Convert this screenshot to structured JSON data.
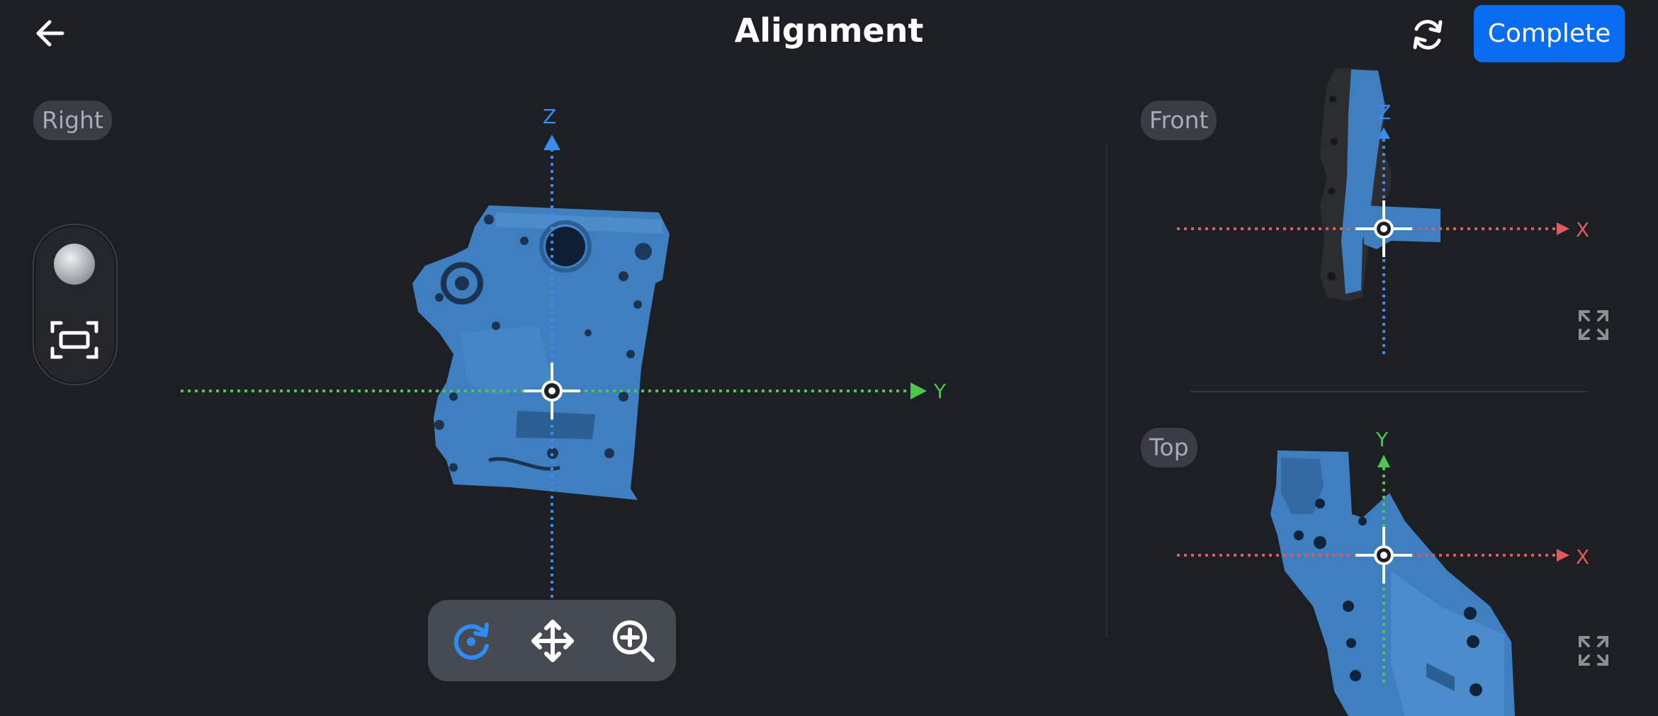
{
  "header": {
    "title": "Alignment",
    "complete_label": "Complete",
    "back_icon": "arrow-left-icon",
    "reset_icon": "refresh-icon"
  },
  "views": {
    "right": {
      "label": "Right",
      "axis_vertical": "Z",
      "axis_horizontal": "Y"
    },
    "front": {
      "label": "Front",
      "axis_vertical": "Z",
      "axis_horizontal": "X"
    },
    "top": {
      "label": "Top",
      "axis_vertical": "Y",
      "axis_horizontal": "X"
    }
  },
  "sidebar": {
    "render_mode_icon": "sphere-icon",
    "fit_view_icon": "fit-view-icon"
  },
  "toolbar": {
    "tools": [
      {
        "name": "rotate",
        "icon": "rotate-icon",
        "active": true
      },
      {
        "name": "move",
        "icon": "move-icon",
        "active": false
      },
      {
        "name": "zoom",
        "icon": "zoom-in-icon",
        "active": false
      }
    ]
  },
  "colors": {
    "background": "#1c1f23",
    "accent": "#0a6cf0",
    "model": "#3f7fbf",
    "axis_z": "#3b8cf0",
    "axis_y": "#4cc94c",
    "axis_x": "#e35a5a",
    "active_tool": "#2f8cf5"
  }
}
